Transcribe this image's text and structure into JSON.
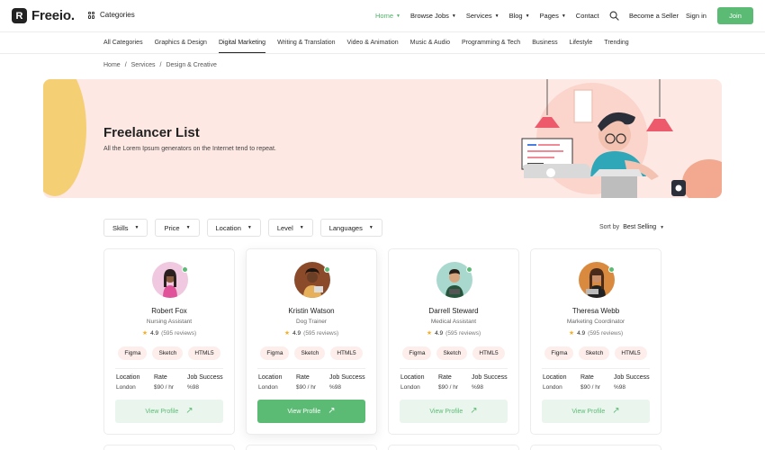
{
  "header": {
    "logo_letter": "R",
    "logo_text": "Freeio.",
    "categories_label": "Categories",
    "nav": [
      {
        "label": "Home",
        "active": true,
        "dropdown": true
      },
      {
        "label": "Browse Jobs",
        "active": false,
        "dropdown": true
      },
      {
        "label": "Services",
        "active": false,
        "dropdown": true
      },
      {
        "label": "Blog",
        "active": false,
        "dropdown": true
      },
      {
        "label": "Pages",
        "active": false,
        "dropdown": true
      },
      {
        "label": "Contact",
        "active": false,
        "dropdown": false
      }
    ],
    "become_seller": "Become a Seller",
    "sign_in": "Sign in",
    "join": "Join"
  },
  "category_bar": {
    "items": [
      "All Categories",
      "Graphics & Design",
      "Digital Marketing",
      "Writing & Translation",
      "Video & Animation",
      "Music & Audio",
      "Programming & Tech",
      "Business",
      "Lifestyle",
      "Trending"
    ],
    "active_index": 2
  },
  "breadcrumb": [
    "Home",
    "Services",
    "Design & Creative"
  ],
  "breadcrumb_sep": "/",
  "hero": {
    "title": "Freelancer List",
    "subtitle": "All the Lorem Ipsum generators on the Internet tend to repeat."
  },
  "filters": [
    "Skills",
    "Price",
    "Location",
    "Level",
    "Languages"
  ],
  "sort": {
    "label": "Sort by",
    "value": "Best Selling"
  },
  "cards": [
    {
      "name": "Robert Fox",
      "role": "Nursing Assistant",
      "rating": "4.9",
      "reviews": "(595 reviews)",
      "tags": [
        "Figma",
        "Sketch",
        "HTML5"
      ],
      "location_label": "Location",
      "location": "London",
      "rate_label": "Rate",
      "rate": "$90 / hr",
      "success_label": "Job Success",
      "success": "%98",
      "button": "View Profile",
      "featured": false
    },
    {
      "name": "Kristin Watson",
      "role": "Dog Trainer",
      "rating": "4.9",
      "reviews": "(595 reviews)",
      "tags": [
        "Figma",
        "Sketch",
        "HTML5"
      ],
      "location_label": "Location",
      "location": "London",
      "rate_label": "Rate",
      "rate": "$90 / hr",
      "success_label": "Job Success",
      "success": "%98",
      "button": "View Profile",
      "featured": true
    },
    {
      "name": "Darrell Steward",
      "role": "Medical Assistant",
      "rating": "4.9",
      "reviews": "(595 reviews)",
      "tags": [
        "Figma",
        "Sketch",
        "HTML5"
      ],
      "location_label": "Location",
      "location": "London",
      "rate_label": "Rate",
      "rate": "$90 / hr",
      "success_label": "Job Success",
      "success": "%98",
      "button": "View Profile",
      "featured": false
    },
    {
      "name": "Theresa Webb",
      "role": "Marketing Coordinator",
      "rating": "4.9",
      "reviews": "(595 reviews)",
      "tags": [
        "Figma",
        "Sketch",
        "HTML5"
      ],
      "location_label": "Location",
      "location": "London",
      "rate_label": "Rate",
      "rate": "$90 / hr",
      "success_label": "Job Success",
      "success": "%98",
      "button": "View Profile",
      "featured": false
    }
  ],
  "colors": {
    "accent": "#5bbb74",
    "hero_bg": "#fde8e4",
    "tag_bg": "#fdeeeb",
    "star": "#f0b22e"
  },
  "icons": [
    "grid-icon",
    "search-icon",
    "star-icon",
    "arrow-up-right-icon",
    "online-dot-icon"
  ]
}
